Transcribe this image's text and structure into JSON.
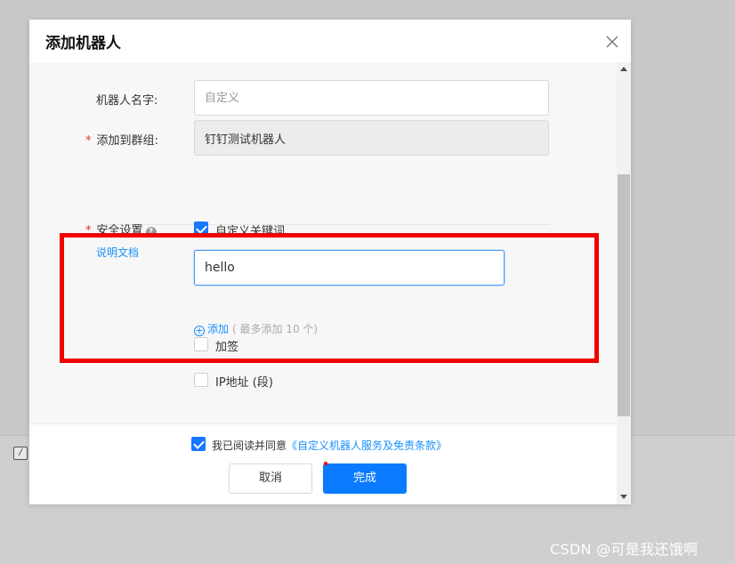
{
  "dialog": {
    "title": "添加机器人",
    "close_icon": "close-icon"
  },
  "form": {
    "robot_name": {
      "label": "机器人名字:",
      "placeholder": "自定义",
      "value": ""
    },
    "group": {
      "required_mark": "*",
      "label": "添加到群组:",
      "value": "钉钉测试机器人"
    },
    "security": {
      "required_mark": "*",
      "label": "安全设置",
      "help_icon": "question-circle-icon",
      "doc_link": "说明文档",
      "custom_keyword": {
        "label": "自定义关键词",
        "checked": true
      },
      "keyword_value": "hello",
      "add_link": "添加",
      "add_hint": "( 最多添加 10 个)",
      "sign": {
        "label": "加签",
        "checked": false
      },
      "ip": {
        "label": "IP地址 (段)",
        "checked": false
      }
    }
  },
  "footer": {
    "agree_checked": true,
    "agree_prefix": "我已阅读并同意",
    "agree_link": "《自定义机器人服务及免责条款》",
    "cancel_label": "取消",
    "ok_label": "完成"
  },
  "colors": {
    "highlight_box": "#f10000",
    "primary": "#0a7bff",
    "link": "#1890ff",
    "required": "#e0301e"
  },
  "watermark": "CSDN @可是我还饿啊"
}
